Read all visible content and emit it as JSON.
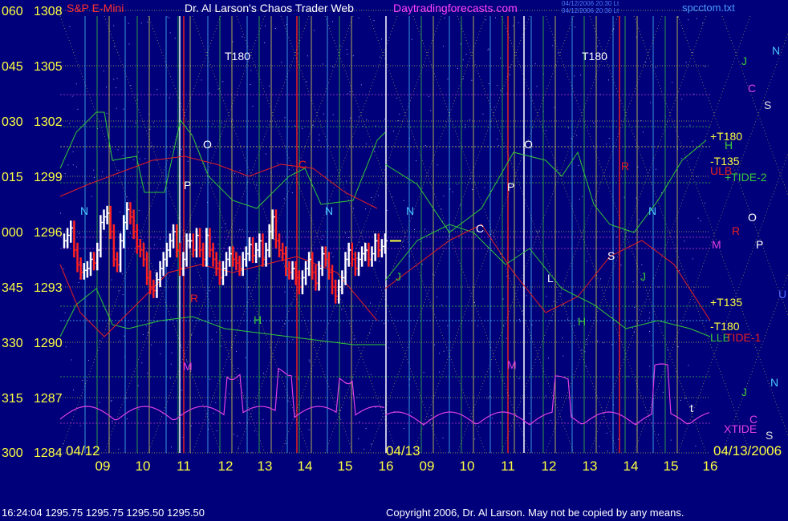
{
  "header": {
    "title": "S&P E-Mini",
    "site": "Dr. Al Larson's Chaos Trader Web",
    "url": "Daytradingforecasts.com",
    "stamp1": "04/12/2006 20:30 Lt",
    "stamp2": "04/12/2006 20:30 Lt",
    "file": "spcctom.txt"
  },
  "footer": {
    "quote": "16:24:04  1295.75 1295.75 1295.50 1295.50",
    "copyright": "Copyright 2006, Dr. Al Larson. May not be copied by any means."
  },
  "chart_data": {
    "type": "line",
    "title": "S&P E-Mini",
    "y_ticks": [
      {
        "angle": "060",
        "price": 1308
      },
      {
        "angle": "045",
        "price": 1305
      },
      {
        "angle": "030",
        "price": 1302
      },
      {
        "angle": "015",
        "price": 1299
      },
      {
        "angle": "000",
        "price": 1296
      },
      {
        "angle": "345",
        "price": 1293
      },
      {
        "angle": "330",
        "price": 1290
      },
      {
        "angle": "315",
        "price": 1287
      },
      {
        "angle": "300",
        "price": 1284
      }
    ],
    "ylim": [
      1284,
      1308
    ],
    "x_ticks": [
      "09",
      "10",
      "11",
      "12",
      "13",
      "14",
      "15",
      "16",
      "09",
      "10",
      "11",
      "12",
      "13",
      "14",
      "15",
      "16"
    ],
    "date_labels": [
      "04/12",
      "04/13",
      "04/13/2006"
    ],
    "price_bars": [
      1295.5,
      1295.8,
      1296.2,
      1295.0,
      1294.2,
      1293.8,
      1293.9,
      1294.0,
      1294.5,
      1294.3,
      1295.0,
      1296.5,
      1296.8,
      1297.0,
      1296.0,
      1294.5,
      1294.2,
      1295.5,
      1296.5,
      1297.2,
      1296.8,
      1296.0,
      1295.2,
      1295.0,
      1294.5,
      1293.5,
      1293.0,
      1292.8,
      1293.4,
      1294.0,
      1294.5,
      1295.0,
      1295.5,
      1296.0,
      1295.0,
      1294.0,
      1294.5,
      1295.5,
      1295.5,
      1295.0,
      1295.8,
      1295.0,
      1294.5,
      1295.8,
      1295.0,
      1294.5,
      1294.0,
      1293.5,
      1294.0,
      1294.5,
      1294.8,
      1294.5,
      1294.3,
      1294.0,
      1294.5,
      1294.8,
      1295.3,
      1294.7,
      1295.0,
      1295.5,
      1294.5,
      1295.0,
      1296.0,
      1296.8,
      1295.5,
      1295.0,
      1294.8,
      1294.0,
      1293.8,
      1294.0,
      1293.5,
      1293.0,
      1293.5,
      1294.0,
      1294.5,
      1293.8,
      1293.2,
      1294.0,
      1294.8,
      1294.5,
      1293.8,
      1293.0,
      1292.5,
      1293.0,
      1293.5,
      1294.5,
      1295.0,
      1294.5,
      1294.0,
      1294.5,
      1294.8,
      1295.0,
      1294.5,
      1294.8,
      1295.5,
      1295.0,
      1295.2,
      1295.5
    ],
    "bar_colors": {
      "up": "#ffffff",
      "down": "#ff2020"
    },
    "annotations": [
      "T180",
      "T180",
      "O",
      "O",
      "P",
      "P",
      "N",
      "N",
      "N",
      "N",
      "R",
      "R",
      "M",
      "M",
      "H",
      "H",
      "J",
      "J",
      "C",
      "C",
      "S",
      "L",
      "t"
    ],
    "right_labels": [
      "N",
      "J",
      "C",
      "S",
      "+T180",
      "H",
      "-T135",
      "ULB",
      "+TIDE-2",
      "O",
      "R",
      "P",
      "M",
      "U",
      "+T135",
      "-T180",
      "LLB",
      "TIDE-1",
      "N",
      "J",
      "XTIDE",
      "C",
      "S"
    ],
    "colors": {
      "background": "#00007a",
      "grid_yellow": "#e6e64a",
      "grid_green": "#3ac83a",
      "grid_cyan": "#4ac8ff",
      "red": "#e82020",
      "magenta": "#e040e0",
      "green_line": "#34c834",
      "xtide": "#e040e0"
    }
  }
}
